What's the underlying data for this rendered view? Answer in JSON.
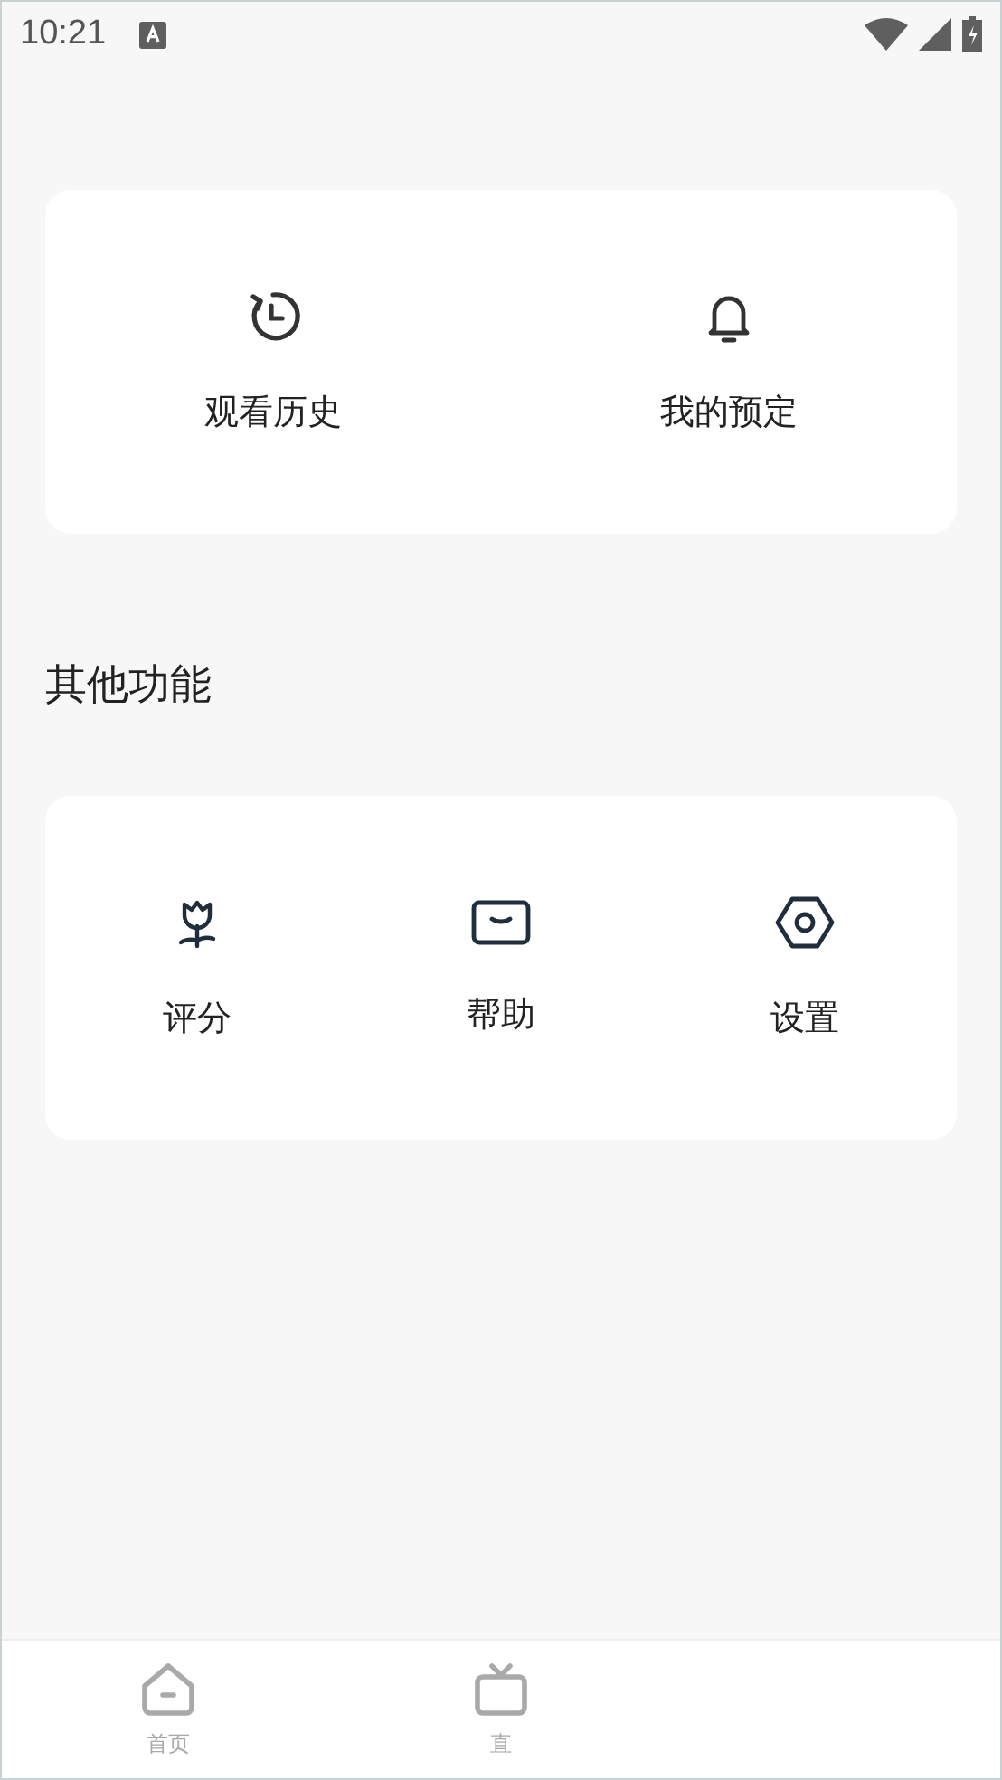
{
  "status_bar": {
    "time": "10:21"
  },
  "quick_actions": [
    {
      "kind": "history",
      "label": "观看历史"
    },
    {
      "kind": "bell",
      "label": "我的预定"
    }
  ],
  "section_title": "其他功能",
  "other_functions": [
    {
      "kind": "tulip",
      "label": "评分"
    },
    {
      "kind": "message",
      "label": "帮助"
    },
    {
      "kind": "settings",
      "label": "设置"
    }
  ],
  "bottom_nav": [
    {
      "kind": "home",
      "label": "首页"
    },
    {
      "kind": "tv",
      "label": "直"
    }
  ]
}
